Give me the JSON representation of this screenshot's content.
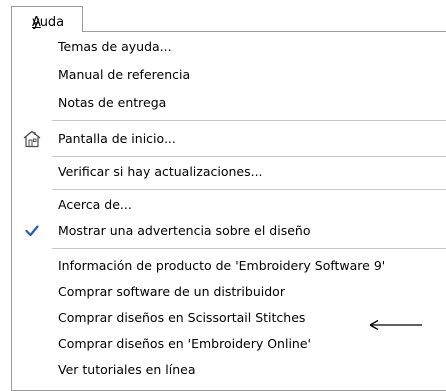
{
  "menu": {
    "title_mnemonic": "A",
    "title_rest": "yuda"
  },
  "items": {
    "temas": "Temas de ayuda...",
    "manual": "Manual de referencia",
    "notas": "Notas de entrega",
    "pantalla": "Pantalla de inicio...",
    "verificar": "Verificar si hay actualizaciones...",
    "acerca": "Acerca de...",
    "mostrar": "Mostrar una advertencia sobre el diseño",
    "info": "Información de producto de 'Embroidery Software 9'",
    "comprar_software": "Comprar software de un distribuidor",
    "comprar_scissortail": "Comprar diseños en Scissortail Stitches",
    "comprar_online": "Comprar diseños en 'Embroidery Online'",
    "tutoriales": "Ver tutoriales en línea"
  },
  "icons": {
    "pantalla": "home-screen-icon",
    "mostrar": "checkmark-icon",
    "annotation": "left-arrow-icon"
  },
  "colors": {
    "check": "#2a5fa8",
    "separator": "#c8c8c8",
    "border": "#9a9a9a"
  }
}
